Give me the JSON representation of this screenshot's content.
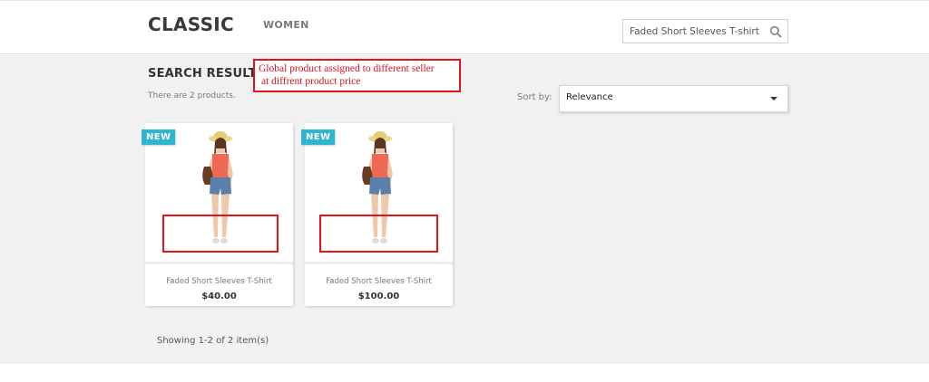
{
  "header": {
    "logo": "CLASSIC",
    "nav": {
      "women": "WOMEN"
    },
    "search": {
      "value": "Faded Short Sleeves T-shirt",
      "icon": "search-icon"
    }
  },
  "results": {
    "title": "SEARCH RESULTS",
    "count_text": "There are 2 products.",
    "annotation": {
      "line1": "Global product assigned to different seller",
      "line2": "at diffrent product price"
    },
    "sort": {
      "label": "Sort by:",
      "value": "Relevance"
    },
    "products": [
      {
        "flag": "NEW",
        "name": "Faded Short Sleeves T-Shirt",
        "price": "$40.00"
      },
      {
        "flag": "NEW",
        "name": "Faded Short Sleeves T-Shirt",
        "price": "$100.00"
      }
    ],
    "showing": "Showing 1-2 of 2 item(s)"
  },
  "colors": {
    "accent_flag": "#2fb5d2",
    "annotation_red": "#e3131b",
    "background_grey": "#f1f1f1"
  }
}
